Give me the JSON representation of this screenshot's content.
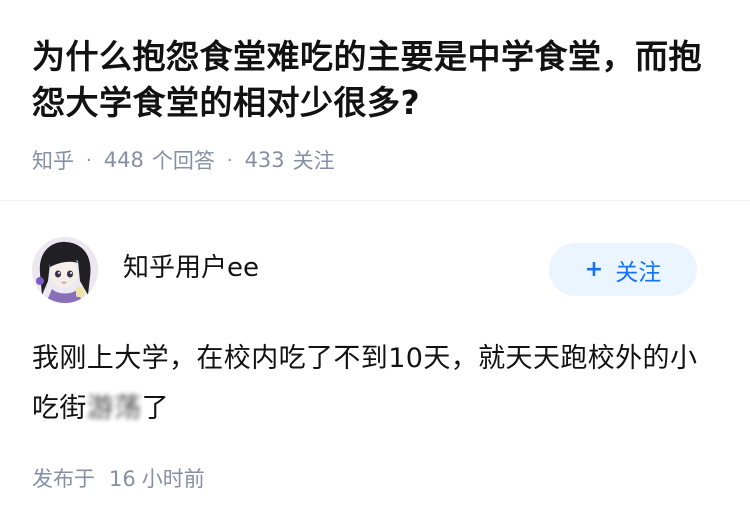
{
  "question": {
    "title": "为什么抱怨食堂难吃的主要是中学食堂，而抱怨大学食堂的相对少很多?",
    "source": "知乎",
    "separator": "·",
    "answer_count": "448",
    "answer_label": "个回答",
    "follow_count": "433",
    "follow_label": "关注"
  },
  "answer": {
    "author": {
      "name": "知乎用户ee",
      "avatar_icon": "anime-girl-avatar"
    },
    "follow_button": {
      "icon": "+",
      "label": "关注"
    },
    "content_visible": "我刚上大学，在校内吃了不到10天，就天天跑校外的小吃街",
    "content_blurred": "游荡",
    "content_end": "了",
    "published_prefix": "发布于",
    "published_value": "16",
    "published_unit": "小时前"
  },
  "colors": {
    "title": "#121212",
    "meta": "#8590a6",
    "accent": "#1772f6",
    "button_bg": "#ebf5ff",
    "divider": "#f0f2f5"
  }
}
